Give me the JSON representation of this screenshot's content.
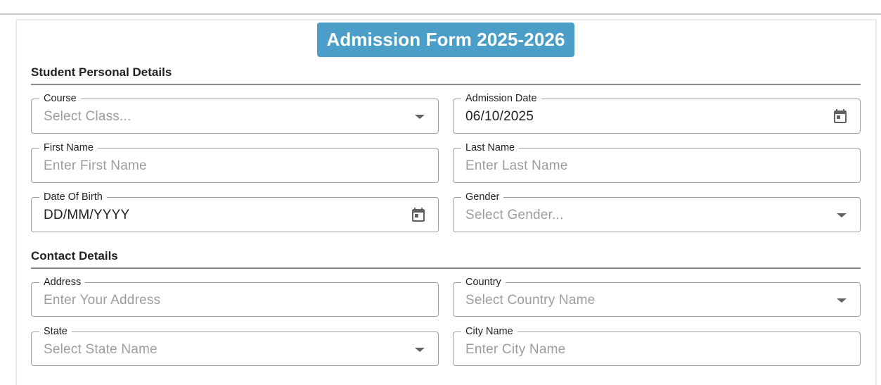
{
  "form": {
    "title": "Admission Form 2025-2026"
  },
  "sections": {
    "personal": "Student Personal Details",
    "contact": "Contact Details"
  },
  "fields": {
    "course": {
      "label": "Course",
      "placeholder": "Select Class..."
    },
    "admission_date": {
      "label": "Admission Date",
      "value": "06/10/2025"
    },
    "first_name": {
      "label": "First Name",
      "placeholder": "Enter First Name"
    },
    "last_name": {
      "label": "Last Name",
      "placeholder": "Enter Last Name"
    },
    "dob": {
      "label": "Date Of Birth",
      "value": "DD/MM/YYYY"
    },
    "gender": {
      "label": "Gender",
      "placeholder": "Select Gender..."
    },
    "address": {
      "label": "Address",
      "placeholder": "Enter Your Address"
    },
    "country": {
      "label": "Country",
      "placeholder": "Select Country Name"
    },
    "state": {
      "label": "State",
      "placeholder": "Select State Name"
    },
    "city": {
      "label": "City Name",
      "placeholder": "Enter City Name"
    }
  },
  "icons": {
    "dropdown": "chevron-down-icon",
    "calendar": "calendar-icon"
  },
  "colors": {
    "banner": "#4a9ec8",
    "placeholder": "#9d9d9d",
    "border": "#9e9e9e"
  }
}
